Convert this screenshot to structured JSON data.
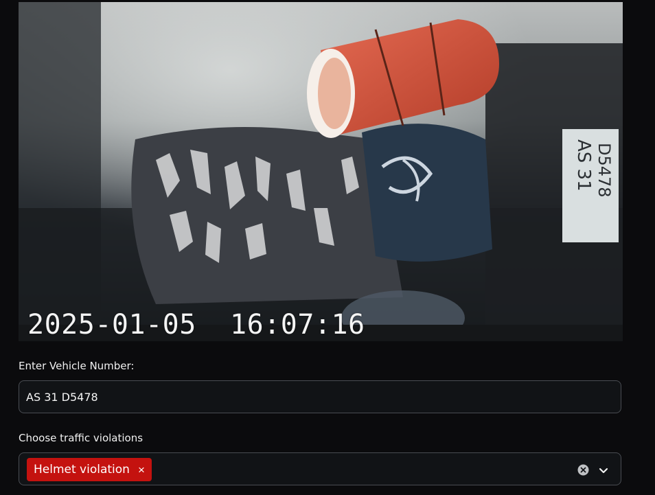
{
  "camera": {
    "timestamp": "2025-01-05  16:07:16",
    "plate_text_line1": "AS 31",
    "plate_text_line2": "D5478"
  },
  "vehicle_number": {
    "label": "Enter Vehicle Number:",
    "value": "AS 31 D5478"
  },
  "violations": {
    "label": "Choose traffic violations",
    "selected": [
      {
        "label": "Helmet violation",
        "remove_glyph": "×"
      }
    ],
    "clear_icon": "clear-circle-icon",
    "dropdown_icon": "chevron-down-icon"
  },
  "colors": {
    "tag_background": "#c4120f",
    "input_border": "#4a4d53",
    "page_background": "#0b0b0d"
  }
}
